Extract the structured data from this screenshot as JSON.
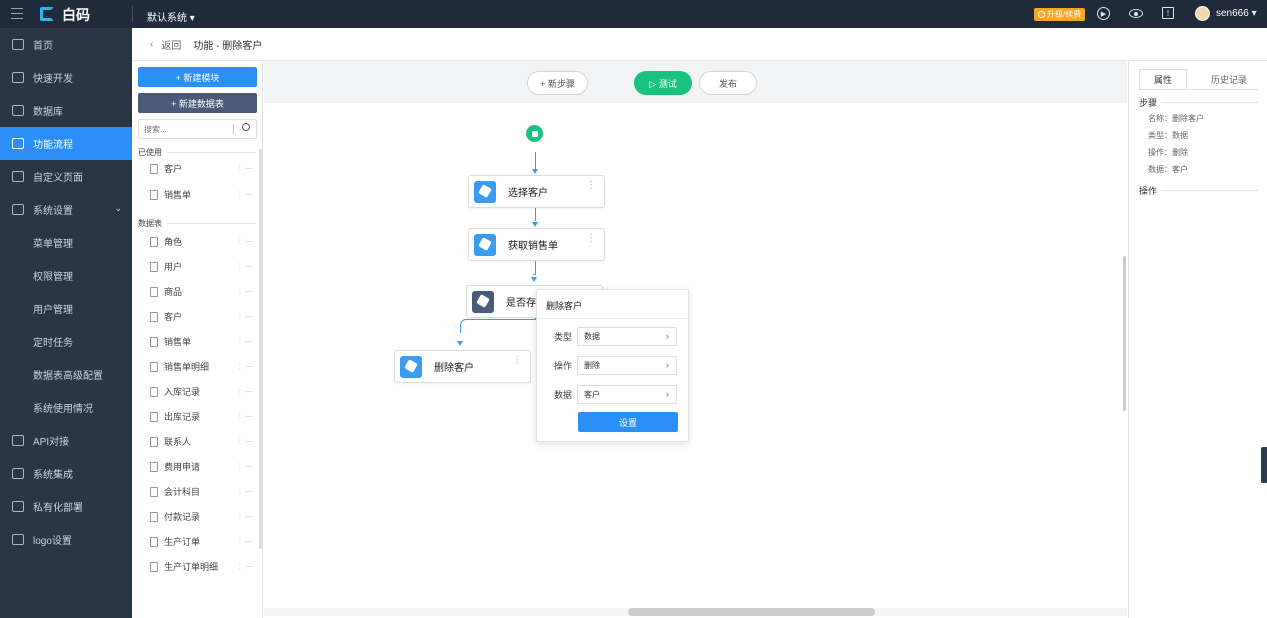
{
  "topbar": {
    "logo_text": "白码",
    "system_select": "默认系统 ▾",
    "upgrade_badge": "升级/续费",
    "username": "sen666 ▾"
  },
  "sidebar": {
    "items": [
      {
        "label": "首页"
      },
      {
        "label": "快速开发"
      },
      {
        "label": "数据库"
      },
      {
        "label": "功能流程"
      },
      {
        "label": "自定义页面"
      },
      {
        "label": "系统设置"
      },
      {
        "label": "菜单管理"
      },
      {
        "label": "权限管理"
      },
      {
        "label": "用户管理"
      },
      {
        "label": "定时任务"
      },
      {
        "label": "数据表高级配置"
      },
      {
        "label": "系统使用情况"
      },
      {
        "label": "API对接"
      },
      {
        "label": "系统集成"
      },
      {
        "label": "私有化部署"
      },
      {
        "label": "logo设置"
      }
    ]
  },
  "breadcrumb": {
    "back": "返回",
    "path": "功能 - 删除客户"
  },
  "left_panel": {
    "new_module": "+ 新建模块",
    "new_table": "+ 新建数据表",
    "search_placeholder": "搜索...",
    "used_section": "已使用",
    "used_items": [
      "客户",
      "销售单"
    ],
    "tables_section": "数据表",
    "tables": [
      "角色",
      "用户",
      "商品",
      "客户",
      "销售单",
      "销售单明细",
      "入库记录",
      "出库记录",
      "联系人",
      "费用申请",
      "会计科目",
      "付款记录",
      "生产订单",
      "生产订单明细"
    ]
  },
  "toolbar": {
    "new_step": "+ 新步骤",
    "test": "▷ 测试",
    "publish": "发布"
  },
  "nodes": {
    "n1": "选择客户",
    "n2": "获取销售单",
    "n3": "是否存",
    "n4": "删除客户"
  },
  "popup": {
    "title": "删除客户",
    "type_label": "类型",
    "type_value": "数据",
    "op_label": "操作",
    "op_value": "删除",
    "data_label": "数据",
    "data_value": "客户",
    "button": "设置"
  },
  "right_panel": {
    "tab_props": "属性",
    "tab_history": "历史记录",
    "step_section": "步骤",
    "name_line": "名称：删除客户",
    "type_line": "类型：数据",
    "op_line": "操作：删除",
    "data_line": "数据：客户",
    "ops_section": "操作"
  },
  "colors": {
    "topbar": "#1f2a3a",
    "sidebar": "#2a3545",
    "accent": "#2a8ff7",
    "test_green": "#19c37d",
    "upgrade": "#f5a623"
  }
}
